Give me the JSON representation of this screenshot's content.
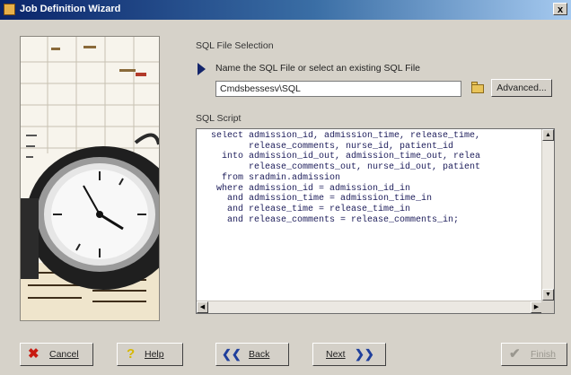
{
  "window": {
    "title": "Job Definition Wizard",
    "close_glyph": "x"
  },
  "file_selection": {
    "section_label": "SQL File Selection",
    "hint": "Name the SQL File or select an existing SQL File",
    "file_value": "Cmdsbessesv\\SQL",
    "browse_icon": "folder-icon",
    "advanced_label": "Advanced..."
  },
  "script": {
    "section_label": "SQL Script",
    "text": "  select admission_id, admission_time, release_time,\n         release_comments, nurse_id, patient_id\n    into admission_id_out, admission_time_out, relea\n         release_comments_out, nurse_id_out, patient\n    from sradmin.admission\n   where admission_id = admission_id_in\n     and admission_time = admission_time_in\n     and release_time = release_time_in\n     and release_comments = release_comments_in;"
  },
  "buttons": {
    "cancel": {
      "label": "Cancel",
      "icon": "red-x-icon",
      "glyph": "✖",
      "color": "#c81a10"
    },
    "help": {
      "label": "Help",
      "icon": "question-icon",
      "glyph": "?",
      "color": "#d7b800"
    },
    "back": {
      "label": "Back",
      "icon": "double-left-arrow-icon",
      "glyph": "❮❮",
      "color": "#1f3f9c"
    },
    "next": {
      "label": "Next",
      "icon": "double-right-arrow-icon",
      "glyph": "❯❯",
      "color": "#1f3f9c"
    },
    "finish": {
      "label": "Finish",
      "icon": "checkmark-icon",
      "glyph": "✔",
      "color": "#9a978f",
      "enabled": false
    }
  },
  "scrollbar_glyphs": {
    "up": "▲",
    "down": "▼",
    "left": "◀",
    "right": "▶"
  }
}
